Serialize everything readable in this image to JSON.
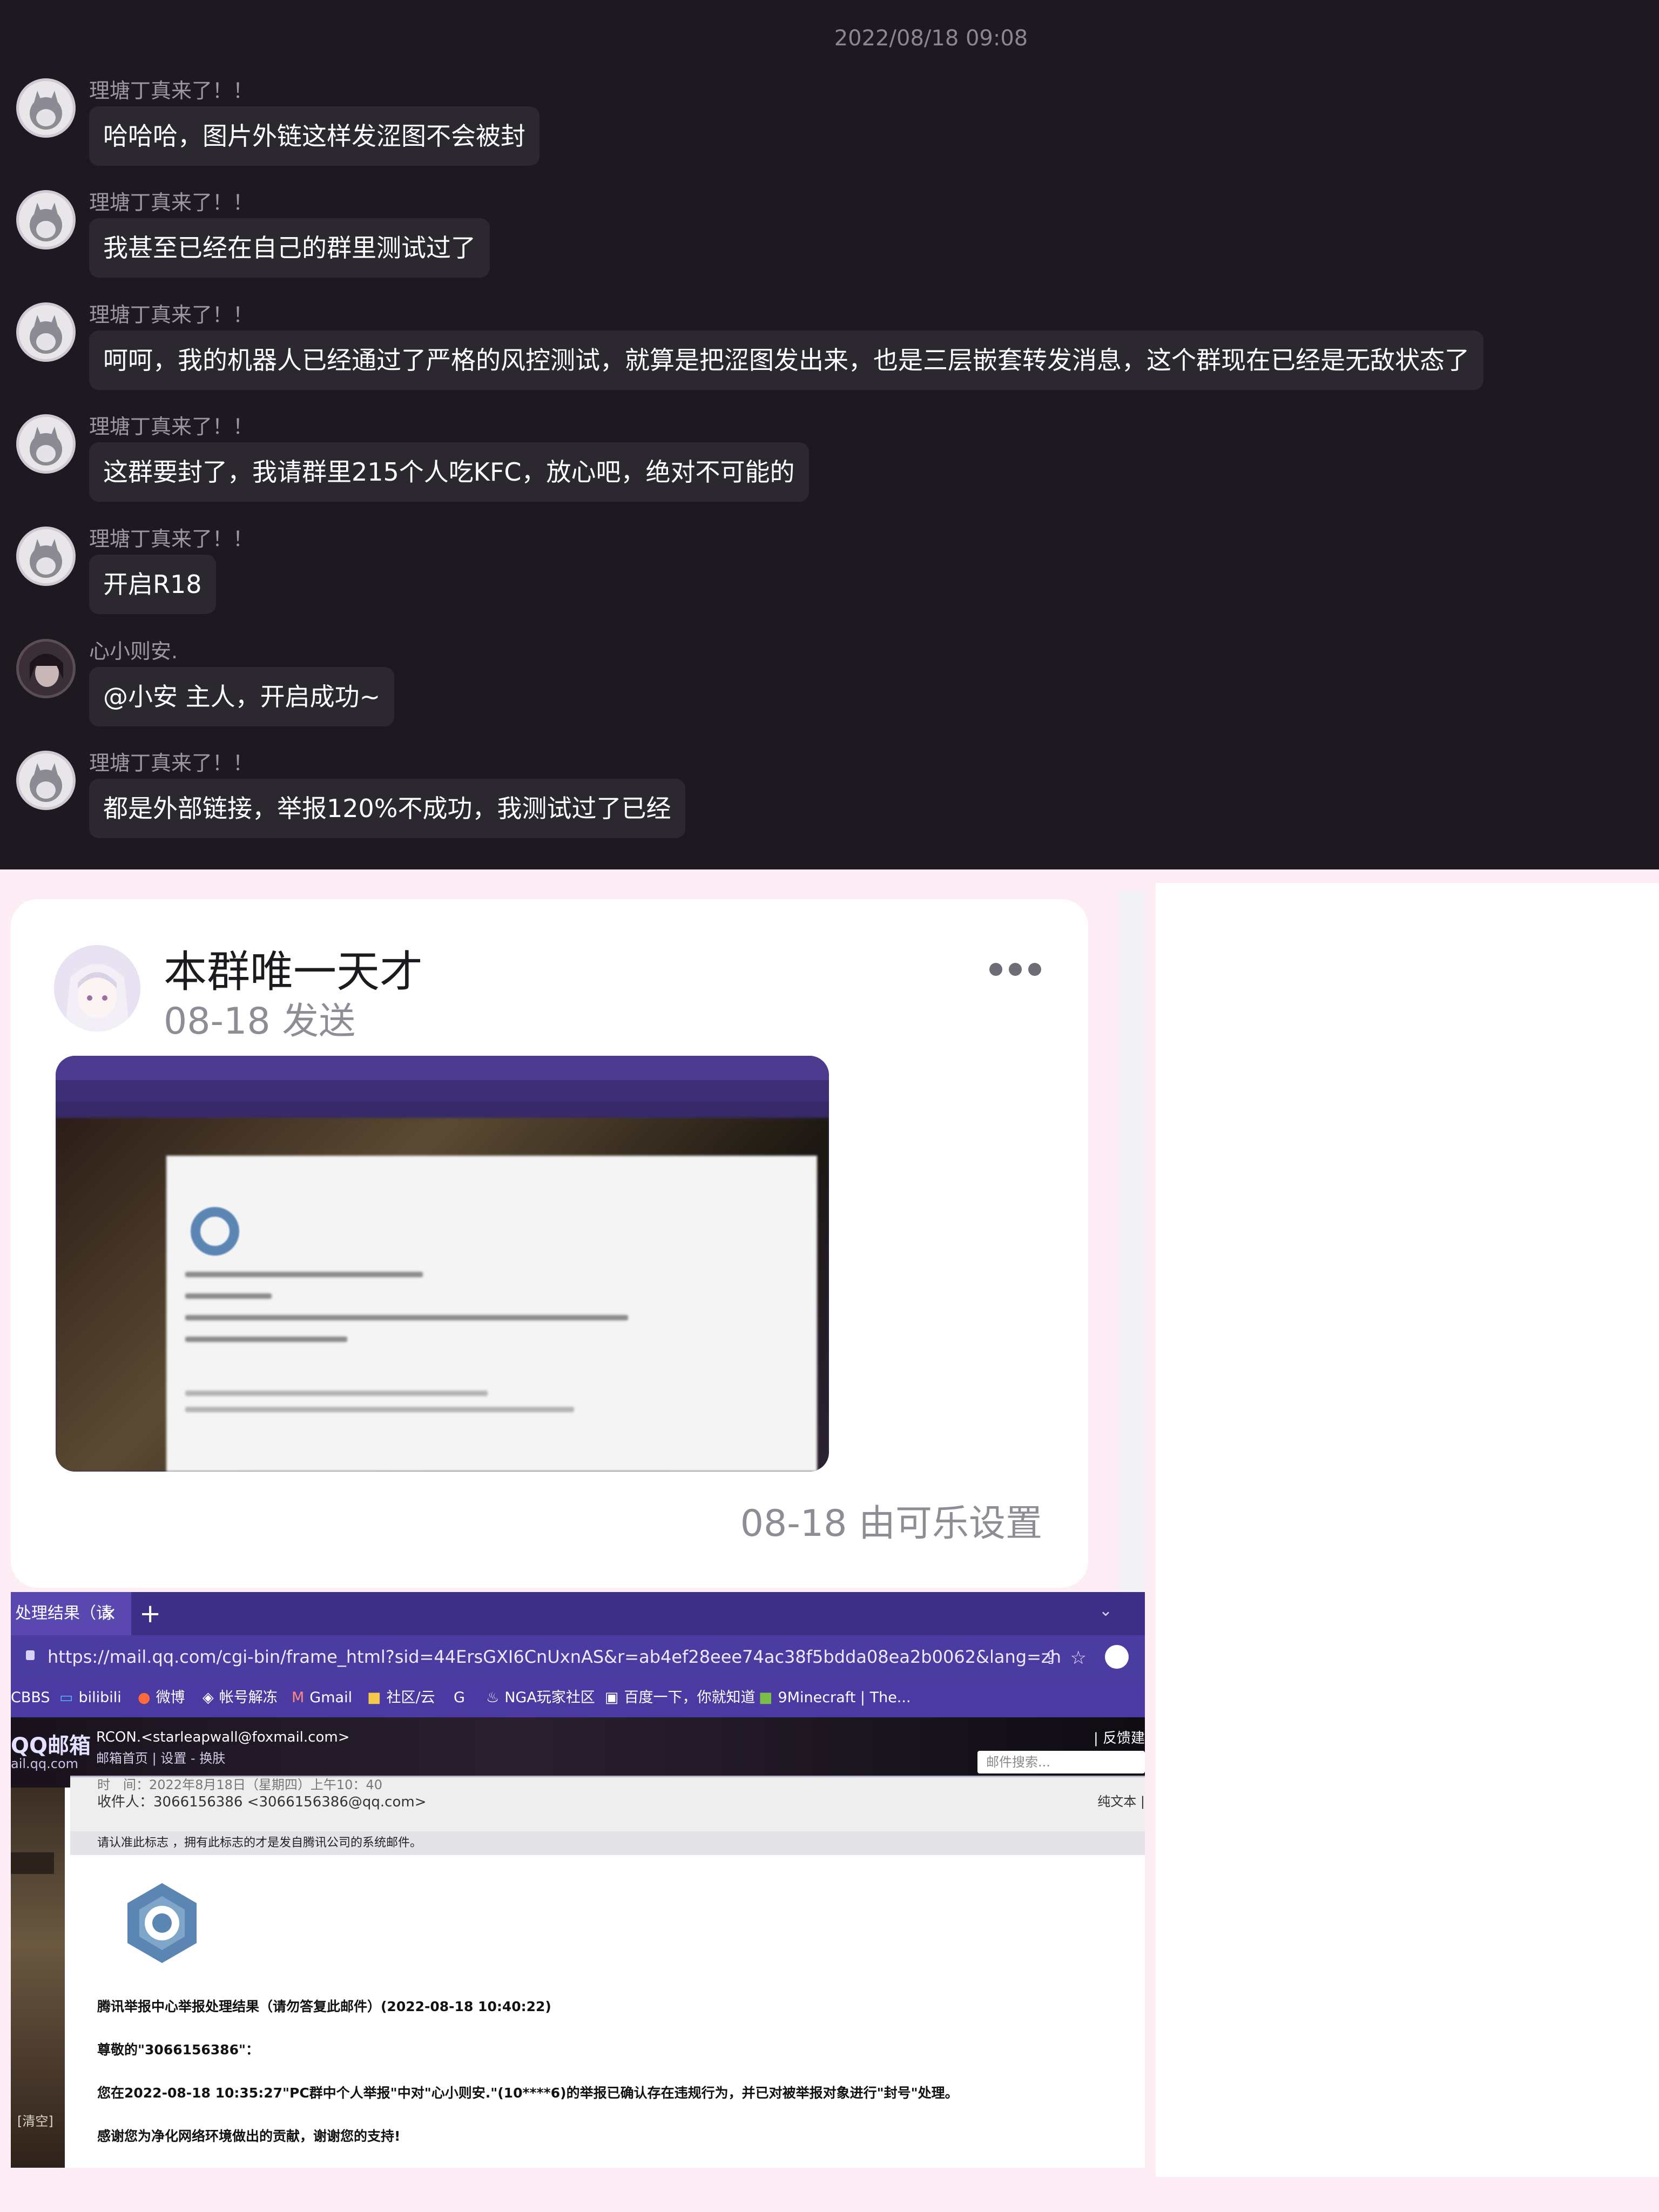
{
  "chat": {
    "timestamp": "2022/08/18 09:08",
    "messages": [
      {
        "sender": "理塘丁真来了！！",
        "text": "哈哈哈，图片外链这样发涩图不会被封"
      },
      {
        "sender": "理塘丁真来了！！",
        "text": "我甚至已经在自己的群里测试过了"
      },
      {
        "sender": "理塘丁真来了！！",
        "text": "呵呵，我的机器人已经通过了严格的风控测试，就算是把涩图发出来，也是三层嵌套转发消息，这个群现在已经是无敌状态了"
      },
      {
        "sender": "理塘丁真来了！！",
        "text": "这群要封了，我请群里215个人吃KFC，放心吧，绝对不可能的"
      },
      {
        "sender": "理塘丁真来了！！",
        "text": "开启R18"
      },
      {
        "sender": "心小则安.",
        "text": "@小安 主人，开启成功~"
      },
      {
        "sender": "理塘丁真来了！！",
        "text": "都是外部链接，举报120%不成功，我测试过了已经"
      }
    ]
  },
  "card": {
    "title": "本群唯一天才",
    "subtitle": "08-18 发送",
    "footer": "08-18 由可乐设置"
  },
  "browser": {
    "tab_title": "处理结果（请",
    "tab_close": "×",
    "new_tab": "+",
    "url": "https://mail.qq.com/cgi-bin/frame_html?sid=44ErsGXI6CnUxnAS&r=ab4ef28eee74ac38f5bdda08ea2b0062&lang=zh",
    "bookmarks": [
      "CBBS",
      "bilibili",
      "微博",
      "帐号解冻",
      "Gmail",
      "社区/云",
      "NGA玩家社区",
      "百度一下，你就知道",
      "9Minecraft | The..."
    ]
  },
  "mail": {
    "logo": "QQ邮箱",
    "domain": "ail.qq.com",
    "account": "RCON.<starleapwall@foxmail.com>",
    "links": "邮箱首页 | 设置 - 换肤",
    "feedback": "| 反馈建",
    "search_placeholder": "邮件搜索...",
    "sidebar_clear": "[清空]",
    "time_line": "时　间：2022年8月18日（星期四）上午10：40",
    "to_line": "收件人：3066156386 <3066156386@qq.com>",
    "plain_text": "纯文本 |",
    "notice": "请认准此标志   ，拥有此标志的才是发自腾讯公司的系统邮件。",
    "line1": "腾讯举报中心举报处理结果（请勿答复此邮件）(2022-08-18 10:40:22)",
    "line2": "尊敬的\"3066156386\"：",
    "line3": "您在2022-08-18 10:35:27\"PC群中个人举报\"中对\"心小则安.\"(10****6)的举报已确认存在违规行为，并已对被举报对象进行\"封号\"处理。",
    "line4": "感谢您为净化网络环境做出的贡献，谢谢您的支持!"
  },
  "colors": {
    "chat_bg": "#1d1921",
    "bubble_bg": "#2c2830",
    "browser_accent": "#3d2f88",
    "tencent_logo": "#5b86b3"
  }
}
